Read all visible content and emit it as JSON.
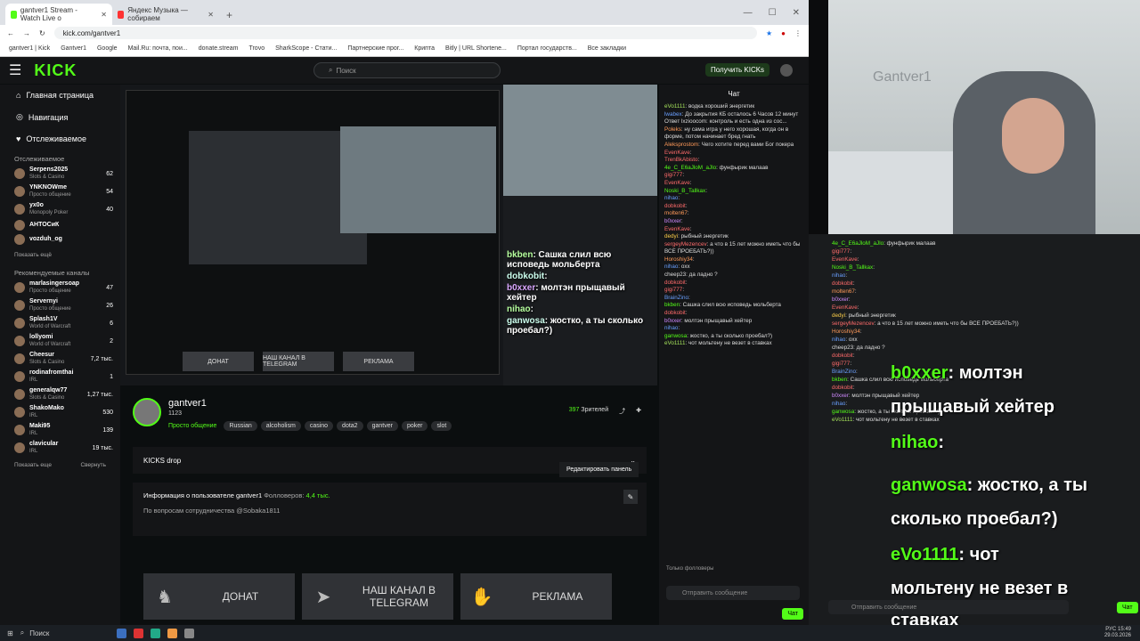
{
  "browser": {
    "tabs": [
      {
        "title": "gantver1 Stream - Watch Live o"
      },
      {
        "title": "Яндекс Музыка — собираем"
      }
    ],
    "url": "kick.com/gantver1",
    "bookmarks": [
      "gantver1 | Kick",
      "Gantver1",
      "Google",
      "Mail.Ru: почта, пои...",
      "donate.stream",
      "Trovo",
      "SharkScope - Стати...",
      "Партнерские прог...",
      "Крипта",
      "Bitly | URL Shortene...",
      "Портал государств...",
      "Все закладки"
    ]
  },
  "kick": {
    "logo": "KICK",
    "search_placeholder": "Поиск",
    "get_kicks": "Получить KICKs"
  },
  "sidebar": {
    "nav": [
      "Главная страница",
      "Навигация",
      "Отслеживаемое"
    ],
    "followed_title": "Отслеживаемое",
    "followed": [
      {
        "name": "Serpens2025",
        "cat": "Slots & Casino",
        "v": "62"
      },
      {
        "name": "YNKNOWme",
        "cat": "Просто общение",
        "v": "54"
      },
      {
        "name": "yx0o",
        "cat": "Monopoly Poker",
        "v": "40"
      },
      {
        "name": "АНТОСиК",
        "cat": "",
        "v": ""
      },
      {
        "name": "vozduh_og",
        "cat": "",
        "v": ""
      }
    ],
    "show_more": "Показать ещё",
    "rec_title": "Рекомендуемые каналы",
    "recommended": [
      {
        "name": "marlasingersoap",
        "cat": "Просто общение",
        "v": "47"
      },
      {
        "name": "Servernyi",
        "cat": "Просто общение",
        "v": "26"
      },
      {
        "name": "Splash1V",
        "cat": "World of Warcraft",
        "v": "6"
      },
      {
        "name": "lollyomi",
        "cat": "World of Warcraft",
        "v": "2"
      },
      {
        "name": "Cheesur",
        "cat": "Slots & Casino",
        "v": "7,2 тыс."
      },
      {
        "name": "rodinafromthai",
        "cat": "IRL",
        "v": "1"
      },
      {
        "name": "generalqw77",
        "cat": "Slots & Casino",
        "v": "1,27 тыс."
      },
      {
        "name": "ShakoMako",
        "cat": "IRL",
        "v": "530"
      },
      {
        "name": "Maki95",
        "cat": "IRL",
        "v": "139"
      },
      {
        "name": "clavicular",
        "cat": "IRL",
        "v": "19 тыс."
      }
    ],
    "show_more2": "Показать еще",
    "collapse": "Свернуть"
  },
  "player": {
    "overlay": [
      {
        "u": "bkben",
        "t": ": Сашка слил всю исповедь мольберта"
      },
      {
        "u": "dobkobit",
        "t": ":"
      },
      {
        "u": "b0xxer",
        "t": ": молтэн прыщавый хейтер"
      },
      {
        "u": "nihao",
        "t": ":"
      },
      {
        "u": "ganwosa",
        "t": ": жостко, а ты сколько проебал?)"
      }
    ],
    "buttons": [
      "ДОНАТ",
      "НАШ КАНАЛ В TELEGRAM",
      "РЕКЛАМА"
    ]
  },
  "stream": {
    "name": "gantver1",
    "sub": "1123",
    "category": "Просто общение",
    "tags": [
      "Russian",
      "alcoholism",
      "casino",
      "dota2",
      "gantver",
      "poker",
      "slot"
    ],
    "viewers": "397",
    "viewers_label": "Зрителей"
  },
  "drop": "KICKS drop",
  "about": {
    "title": "Информация о пользователе gantver1",
    "followers_label": "Фолловеров:",
    "followers": "4,4 тыс.",
    "contact": "По вопросам сотрудничества @Sobaka1811"
  },
  "edit_panel": "Редактировать панель",
  "panels": [
    {
      "label": "ДОНАТ"
    },
    {
      "label": "НАШ КАНАЛ В TELEGRAM"
    },
    {
      "label": "РЕКЛАМА"
    }
  ],
  "chat": {
    "title": "Чат",
    "messages": [
      {
        "u": "eVo1111",
        "c": "#a5e25b",
        "t": "водка хороший энергетик"
      },
      {
        "u": "lwabex",
        "c": "#6aa0ff",
        "t": "До закрытия КБ осталось 6 Часов 12 минут"
      },
      {
        "u": "",
        "c": "#999",
        "t": "Ответ lxzioocom: контроль и есть одна из сос..."
      },
      {
        "u": "Poleks",
        "c": "#ff9a5a",
        "t": "ну сама игра у него хорошая, когда он в форме, потом начинает бред гнать"
      },
      {
        "u": "Aleksprostom",
        "c": "#ff9a5a",
        "t": "Чего хотите перед вами Бог покера"
      },
      {
        "u": "EvenKave",
        "c": "#ff6b6b",
        "t": ""
      },
      {
        "u": "TrenBkAbisto",
        "c": "#ff6b6b",
        "t": ""
      },
      {
        "u": "4e_C_E6aJloM_aJlo",
        "c": "#53fc18",
        "t": "фунфырик малаав"
      },
      {
        "u": "gigi777",
        "c": "#ff6b6b",
        "t": ""
      },
      {
        "u": "EvenKave",
        "c": "#ff6b6b",
        "t": ""
      },
      {
        "u": "Noski_B_Tallkax",
        "c": "#53fc18",
        "t": ""
      },
      {
        "u": "nihao",
        "c": "#6aa0ff",
        "t": ""
      },
      {
        "u": "dobkobit",
        "c": "#ff6b6b",
        "t": ""
      },
      {
        "u": "molten67",
        "c": "#ff9a5a",
        "t": ""
      },
      {
        "u": "b0xxer",
        "c": "#d08aff",
        "t": ""
      },
      {
        "u": "EvenKave",
        "c": "#ff6b6b",
        "t": ""
      },
      {
        "u": "dedyi",
        "c": "#ffd04a",
        "t": "рыбный энергетик"
      },
      {
        "u": "sergeyMezencev",
        "c": "#ff6b6b",
        "t": "а что в 15 лет можно иметь что бы ВСЕ ПРОЕБАТЬ?))"
      },
      {
        "u": "Horoshiy34",
        "c": "#ff9a5a",
        "t": ""
      },
      {
        "u": "nihao",
        "c": "#6aa0ff",
        "t": "охх"
      },
      {
        "u": "cheep23",
        "c": "#ddd",
        "t": "да ладно ?"
      },
      {
        "u": "dobkobit",
        "c": "#ff6b6b",
        "t": ""
      },
      {
        "u": "gigi777",
        "c": "#ff6b6b",
        "t": ""
      },
      {
        "u": "BrainZino",
        "c": "#6aa0ff",
        "t": ""
      },
      {
        "u": "bkben",
        "c": "#53fc18",
        "t": "Сашка слил всю исповедь мольберта"
      },
      {
        "u": "dobkobit",
        "c": "#ff6b6b",
        "t": ""
      },
      {
        "u": "b0xxer",
        "c": "#d08aff",
        "t": "молтэн прыщавый хейтер"
      },
      {
        "u": "nihao",
        "c": "#6aa0ff",
        "t": ""
      },
      {
        "u": "ganwosa",
        "c": "#53fc18",
        "t": "жостко, а ты сколько проебал?)"
      },
      {
        "u": "eVo1111",
        "c": "#a5e25b",
        "t": "чот мольтену не везет в ставках"
      }
    ],
    "followers_only": "Только фолловеры",
    "input_placeholder": "Отправить сообщение",
    "send": "Чат"
  },
  "overlay_chat": {
    "big": [
      {
        "u": "b0xxer",
        "t": ": молтэн"
      },
      {
        "u": "",
        "t": "прыщавый хейтер"
      },
      {
        "u": "nihao",
        "t": ":"
      },
      {
        "u": "ganwosa",
        "t": ": жостко, а ты"
      },
      {
        "u": "",
        "t": "сколько проебал?)"
      },
      {
        "u": "eVo1111",
        "t": ": чот"
      },
      {
        "u": "",
        "t": "мольтену не везет в"
      },
      {
        "u": "",
        "t": "ставках"
      }
    ],
    "input_placeholder": "Отправить сообщение",
    "send": "Чат",
    "cam_text": "Gantver1"
  },
  "taskbar": {
    "search": "Поиск",
    "time": "15:49",
    "date": "29.03.2026",
    "lang": "РУС"
  }
}
